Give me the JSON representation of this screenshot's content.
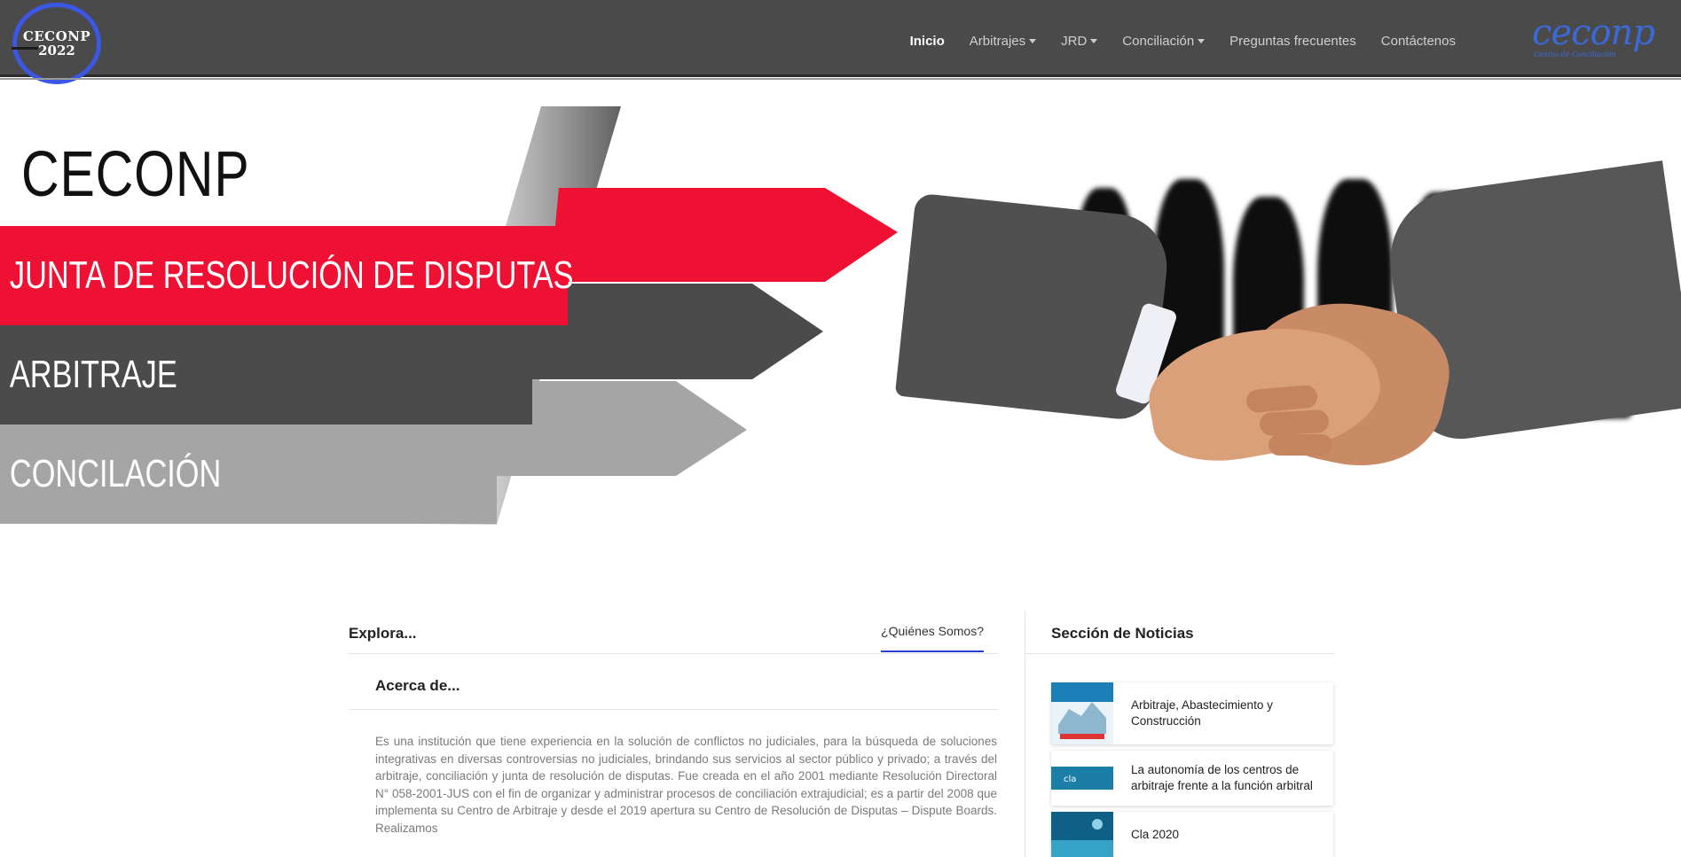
{
  "nav": {
    "logo_line1": "CECONP",
    "logo_line2": "2022",
    "items": [
      {
        "label": "Inicio",
        "active": true,
        "dropdown": false
      },
      {
        "label": "Arbitrajes",
        "active": false,
        "dropdown": true
      },
      {
        "label": "JRD",
        "active": false,
        "dropdown": true
      },
      {
        "label": "Conciliación",
        "active": false,
        "dropdown": true
      },
      {
        "label": "Preguntas frecuentes",
        "active": false,
        "dropdown": false
      },
      {
        "label": "Contáctenos",
        "active": false,
        "dropdown": false
      }
    ],
    "brand_script": "ceconp",
    "brand_small": "Centro de Conciliación"
  },
  "hero": {
    "title": "CECONP",
    "band1": "JUNTA DE RESOLUCIÓN DE DISPUTAS",
    "band2": "ARBITRAJE",
    "band3": "CONCILACIÓN",
    "colors": {
      "red": "#ee1133",
      "dark": "#4b4b4b",
      "grey": "#a5a5a5"
    }
  },
  "explore": {
    "heading": "Explora...",
    "tab": "¿Quiénes Somos?",
    "about_title": "Acerca de...",
    "about_text": "Es una institución que tiene experiencia en la solución de conflictos no judiciales, para la búsqueda de soluciones integrativas en diversas controversias no judiciales, brindando sus servicios al sector público y privado; a través del arbitraje, conciliación y junta de resolución de disputas. Fue creada en el año 2001 mediante Resolución Directoral N° 058-2001-JUS con el fin de organizar y administrar procesos de conciliación extrajudicial; es a partir del 2008 que implementa su Centro de Arbitraje y desde el 2019 apertura su Centro de Resolución de Disputas – Dispute Boards. Realizamos"
  },
  "news": {
    "heading": "Sección de Noticias",
    "items": [
      {
        "title": "Arbitraje, Abastecimiento y Construcción"
      },
      {
        "title": "La autonomía de los centros de arbitraje frente a la función arbitral"
      },
      {
        "title": "Cla 2020"
      }
    ]
  }
}
